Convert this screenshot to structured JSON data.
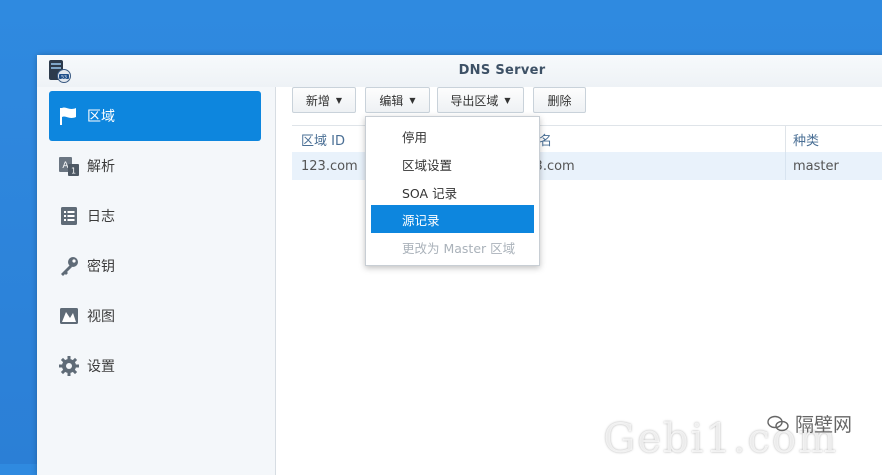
{
  "window": {
    "title": "DNS Server"
  },
  "sidebar": {
    "items": [
      {
        "label": "区域",
        "icon": "flag-icon",
        "active": true
      },
      {
        "label": "解析",
        "icon": "resolve-icon",
        "active": false
      },
      {
        "label": "日志",
        "icon": "log-icon",
        "active": false
      },
      {
        "label": "密钥",
        "icon": "key-icon",
        "active": false
      },
      {
        "label": "视图",
        "icon": "view-icon",
        "active": false
      },
      {
        "label": "设置",
        "icon": "gear-icon",
        "active": false
      }
    ]
  },
  "toolbar": {
    "create_label": "新增",
    "edit_label": "编辑",
    "export_label": "导出区域",
    "delete_label": "删除"
  },
  "table": {
    "columns": [
      "区域 ID",
      "域名",
      "种类"
    ],
    "rows": [
      {
        "zone_id": "123.com",
        "domain": "123.com",
        "type": "master"
      }
    ]
  },
  "edit_menu": {
    "items": [
      {
        "label": "停用",
        "state": "normal"
      },
      {
        "label": "区域设置",
        "state": "normal"
      },
      {
        "label": "SOA 记录",
        "state": "normal"
      },
      {
        "label": "源记录",
        "state": "selected"
      },
      {
        "label": "更改为 Master 区域",
        "state": "disabled"
      }
    ]
  },
  "watermark": {
    "text": "Gebi1.com",
    "brand": "隔壁网"
  },
  "colors": {
    "accent": "#0d86de",
    "desktop": "#2b7fd6"
  }
}
